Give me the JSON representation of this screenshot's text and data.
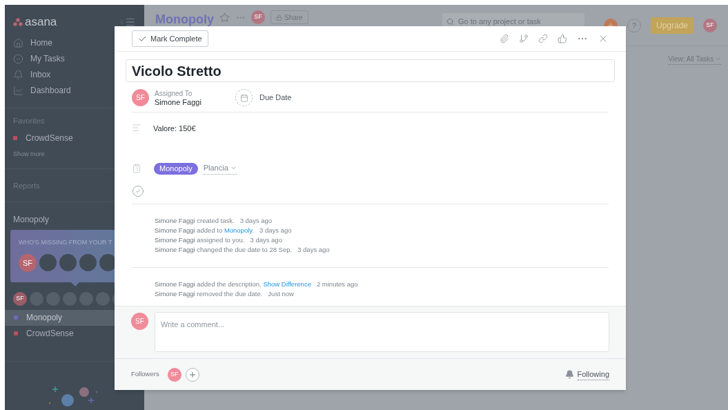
{
  "sidebar": {
    "logo": "asana",
    "nav": [
      {
        "label": "Home"
      },
      {
        "label": "My Tasks"
      },
      {
        "label": "Inbox"
      },
      {
        "label": "Dashboard"
      }
    ],
    "favorites_heading": "Favorites",
    "favorites": [
      {
        "label": "CrowdSense",
        "color": "#b5505e"
      }
    ],
    "show_more": "Show more",
    "reports_heading": "Reports",
    "team": "Monopoly",
    "invite_card": {
      "title": "WHO'S MISSING FROM YOUR T",
      "avatar": "SF"
    },
    "member_avatar": "SF",
    "projects": [
      {
        "label": "Monopoly",
        "color": "#6e68b8",
        "selected": true
      },
      {
        "label": "CrowdSense",
        "color": "#b5505e",
        "selected": false
      }
    ]
  },
  "header": {
    "project_title": "Monopoly",
    "avatar": "SF",
    "share": "Share",
    "search_placeholder": "Go to any project or task",
    "help": "?",
    "upgrade": "Upgrade",
    "user_avatar": "SF",
    "view": "View: All Tasks"
  },
  "task": {
    "mark_complete": "Mark Complete",
    "title": "Vicolo Stretto",
    "assignee_label": "Assigned To",
    "assignee": "Simone Faggi",
    "assignee_avatar": "SF",
    "due_date": "Due Date",
    "description": "Valore: 150€",
    "project_tag": "Monopoly",
    "section": "Plancia",
    "activity": [
      [
        {
          "actor": "Simone Faggi",
          "text": "created task.",
          "time": "3 days ago"
        },
        {
          "actor": "Simone Faggi",
          "text": "added to",
          "link": "Monopoly",
          "after": ".",
          "time": "3 days ago"
        },
        {
          "actor": "Simone Faggi",
          "text": "assigned to you.",
          "time": "3 days ago"
        },
        {
          "actor": "Simone Faggi",
          "text": "changed the due date to 28 Sep.",
          "time": "3 days ago"
        }
      ],
      [
        {
          "actor": "Simone Faggi",
          "text": "added the description.",
          "link": "Show Difference",
          "time": "2 minutes ago"
        },
        {
          "actor": "Simone Faggi",
          "text": "removed the due date.",
          "time": "Just now"
        }
      ]
    ],
    "comment_avatar": "SF",
    "comment_placeholder": "Write a comment...",
    "followers_label": "Followers",
    "follower_avatar": "SF",
    "following": "Following"
  }
}
